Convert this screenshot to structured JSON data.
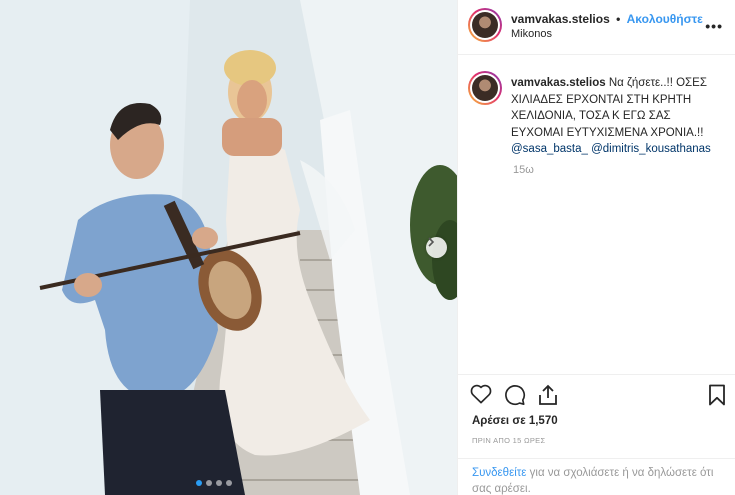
{
  "post": {
    "author": {
      "username": "vamvakas.stelios",
      "separator": "•",
      "follow_label": "Ακολουθήστε",
      "location": "Mikonos"
    },
    "caption": {
      "username": "vamvakas.stelios",
      "text": "Να ζήσετε..!! ΟΣΕΣ ΧΙΛΙΑΔΕΣ ΕΡΧΟΝΤΑΙ ΣΤΗ ΚΡΗΤΗ ΧΕΛΙΔΟΝΙΑ, ΤΟΣΑ Κ ΕΓΩ ΣΑΣ ΕΥΧΟΜΑΙ ΕΥΤΥΧΙΣΜΕΝΑ ΧΡΟΝΙΑ.!!",
      "mention_1": "@sasa_basta_",
      "mention_2": "@dimitris_kousathanas",
      "time": "15ω"
    },
    "likes_label": "Αρέσει σε 1,570",
    "time_ago": "ΠΡΙΝ ΑΠΟ 15 ΩΡΕΣ",
    "login": {
      "link": "Συνδεθείτε",
      "rest": "για να σχολιάσετε ή να δηλώσετε ότι σας αρέσει."
    },
    "carousel": {
      "slides": 4,
      "active_index": 0
    }
  },
  "icons": {
    "more": "more-options-icon",
    "heart": "heart-icon",
    "comment": "comment-icon",
    "share": "share-icon",
    "save": "bookmark-icon",
    "next": "chevron-right-icon"
  },
  "colors": {
    "accent": "#3897f0",
    "mention": "#003569",
    "muted": "#999999",
    "text": "#262626"
  }
}
